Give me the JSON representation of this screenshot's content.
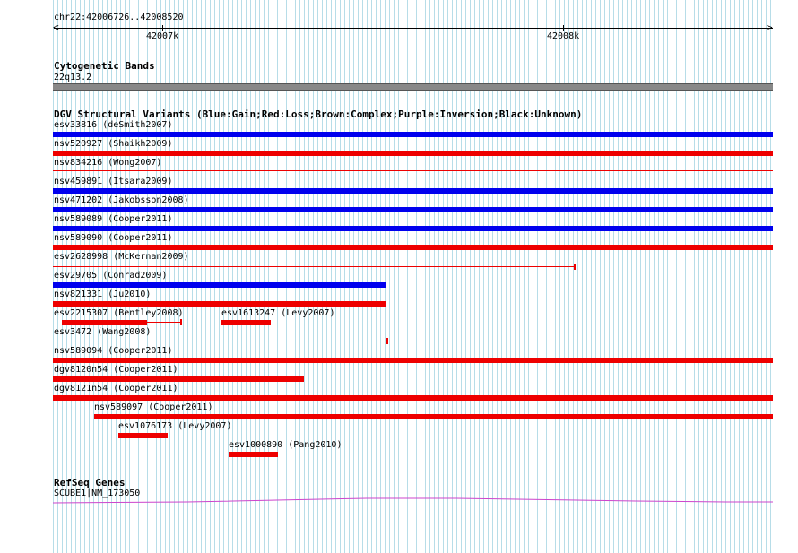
{
  "ruler": {
    "range": "chr22:42006726..42008520",
    "major_labels": [
      "42007k",
      "42008k"
    ]
  },
  "cytoband": {
    "title": "Cytogenetic Bands",
    "band": "22q13.2"
  },
  "dgv": {
    "title": "DGV Structural Variants (Blue:Gain;Red:Loss;Brown:Complex;Purple:Inversion;Black:Unknown)",
    "colors": {
      "gain": "#0000ee",
      "loss": "#ee0000"
    },
    "features": [
      {
        "id": "esv33816",
        "study": "deSmith2007",
        "type": "gain"
      },
      {
        "id": "nsv520927",
        "study": "Shaikh2009",
        "type": "loss"
      },
      {
        "id": "nsv834216",
        "study": "Wong2007",
        "type": "loss"
      },
      {
        "id": "nsv459891",
        "study": "Itsara2009",
        "type": "gain"
      },
      {
        "id": "nsv471202",
        "study": "Jakobsson2008",
        "type": "gain"
      },
      {
        "id": "nsv589089",
        "study": "Cooper2011",
        "type": "gain"
      },
      {
        "id": "nsv589090",
        "study": "Cooper2011",
        "type": "loss"
      },
      {
        "id": "esv2628998",
        "study": "McKernan2009",
        "type": "loss"
      },
      {
        "id": "esv29705",
        "study": "Conrad2009",
        "type": "gain"
      },
      {
        "id": "nsv821331",
        "study": "Ju2010",
        "type": "loss"
      },
      {
        "id": "esv2215307",
        "study": "Bentley2008",
        "type": "loss"
      },
      {
        "id": "esv1613247",
        "study": "Levy2007",
        "type": "loss"
      },
      {
        "id": "esv3472",
        "study": "Wang2008",
        "type": "loss"
      },
      {
        "id": "nsv589094",
        "study": "Cooper2011",
        "type": "loss"
      },
      {
        "id": "dgv8120n54",
        "study": "Cooper2011",
        "type": "loss"
      },
      {
        "id": "dgv8121n54",
        "study": "Cooper2011",
        "type": "loss"
      },
      {
        "id": "nsv589097",
        "study": "Cooper2011",
        "type": "loss"
      },
      {
        "id": "esv1076173",
        "study": "Levy2007",
        "type": "loss"
      },
      {
        "id": "esv1000890",
        "study": "Pang2010",
        "type": "loss"
      }
    ]
  },
  "refseq": {
    "title": "RefSeq Genes",
    "gene": "SCUBE1|NM_173050",
    "color": "#cc44cc"
  }
}
